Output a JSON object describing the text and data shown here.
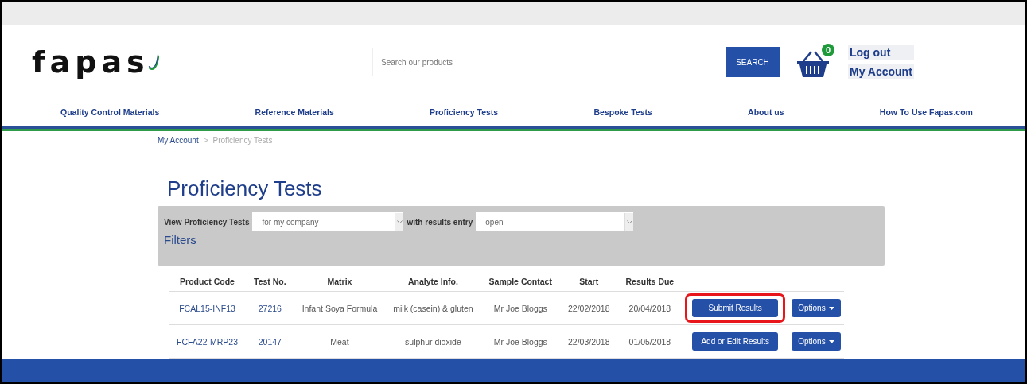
{
  "logo": {
    "text": "fapas"
  },
  "search": {
    "placeholder": "Search our products",
    "button": "SEARCH"
  },
  "basket": {
    "count": "0"
  },
  "account_links": [
    "Log out",
    "My Account"
  ],
  "nav": [
    "Quality Control Materials",
    "Reference Materials",
    "Proficiency Tests",
    "Bespoke Tests",
    "About us",
    "How To Use Fapas.com"
  ],
  "breadcrumb": [
    {
      "label": "My Account",
      "current": false
    },
    {
      "label": "Proficiency Tests",
      "current": true
    }
  ],
  "breadcrumb_separator": ">",
  "page_title": "Proficiency Tests",
  "filters": {
    "view_label": "View Proficiency Tests",
    "view_value": "for my company",
    "entry_label": "with results entry",
    "entry_value": "open",
    "filters_link": "Filters"
  },
  "table": {
    "columns": [
      "Product Code",
      "Test No.",
      "Matrix",
      "Analyte Info.",
      "Sample Contact",
      "Start",
      "Results Due"
    ],
    "rows": [
      {
        "cells": [
          "FCAL15-INF13",
          "27216",
          "Infant Soya Formula",
          "milk (casein) & gluten",
          "Mr Joe Bloggs",
          "22/02/2018",
          "20/04/2018"
        ],
        "action": "Submit Results",
        "highlighted": true,
        "options": "Options"
      },
      {
        "cells": [
          "FCFA22-MRP23",
          "20147",
          "Meat",
          "sulphur dioxide",
          "Mr Joe Bloggs",
          "22/03/2018",
          "01/05/2018"
        ],
        "action": "Add or Edit Results",
        "highlighted": false,
        "options": "Options"
      }
    ]
  }
}
